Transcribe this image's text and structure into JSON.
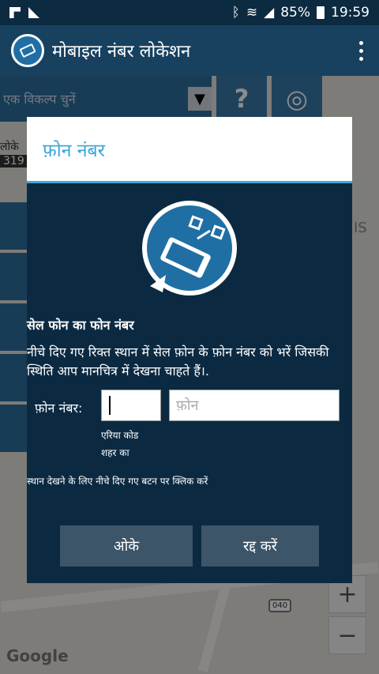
{
  "status_bar": {
    "battery": "85%",
    "time": "19:59"
  },
  "app": {
    "title": "मोबाइल नंबर लोकेशन"
  },
  "selector": {
    "placeholder": "एक विकल्प चुनें",
    "help_label": "?"
  },
  "map": {
    "watermark": "Google",
    "road_label": "040",
    "zoom_in": "+",
    "zoom_out": "−",
    "partial_left": "लोके",
    "partial_number": "319",
    "partial_right": "IS"
  },
  "dialog": {
    "title": "फ़ोन नंबर",
    "heading": "सेल फोन का फोन नंबर",
    "description": "नीचे दिए गए रिक्त स्थान में सेल फ़ोन के फ़ोन नंबर को भरें जिसकी स्थिति आप मानचित्र में देखना चाहते हैं।.",
    "phone_label": "फ़ोन नंबर:",
    "area_value": "",
    "phone_placeholder": "फ़ोन",
    "area_hint_line1": "एरिया कोड",
    "area_hint_line2": "शहर का",
    "instruction": "स्थान देखने के लिए नीचे दिए गए बटन पर क्लिक करें",
    "ok_label": "ओके",
    "cancel_label": "रद्द करें"
  }
}
